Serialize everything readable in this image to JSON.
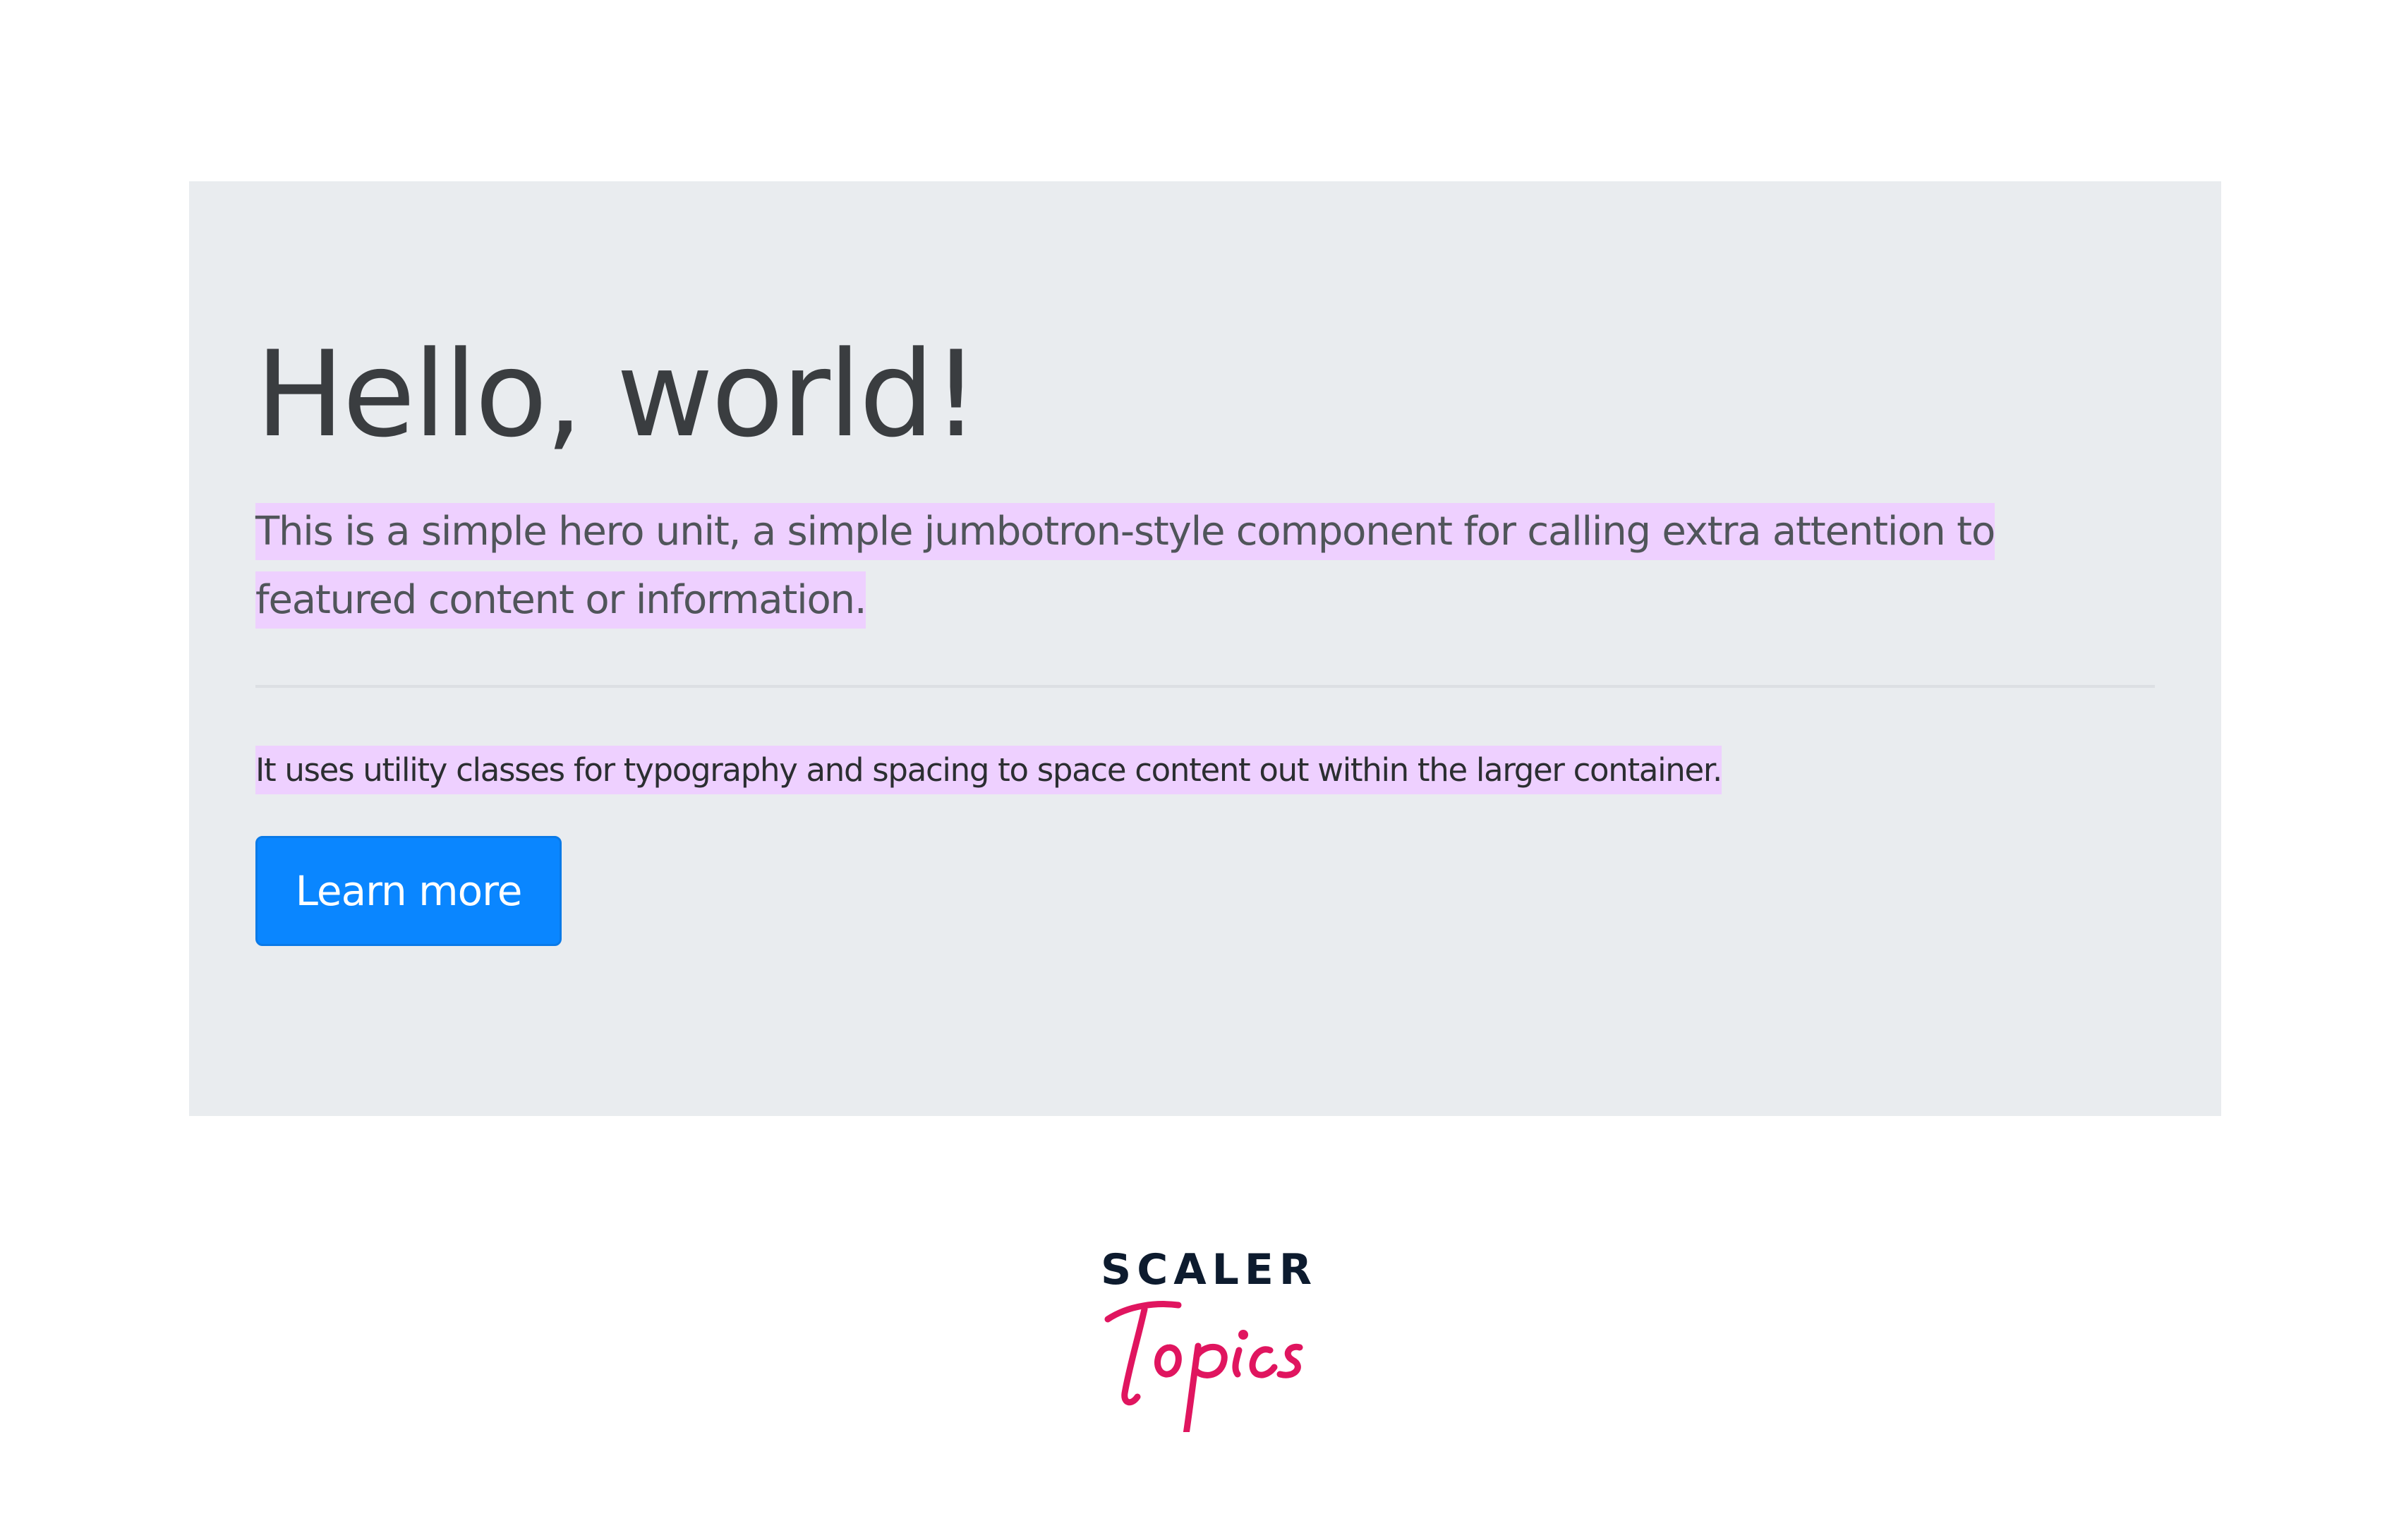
{
  "hero": {
    "heading": "Hello, world!",
    "lead": "This is a simple hero unit, a simple jumbotron-style component for calling extra attention to featured content or information.",
    "body": "It uses utility classes for typography and spacing to space content out within the larger container.",
    "button_label": "Learn more"
  },
  "brand": {
    "name_top": "SCALER",
    "name_script": "Topics",
    "top_color": "#0d1b2e",
    "script_color": "#e0155f"
  },
  "colors": {
    "jumbotron_bg": "#e9ecef",
    "highlight": "#eed0ff",
    "button": "#0a86ff"
  }
}
